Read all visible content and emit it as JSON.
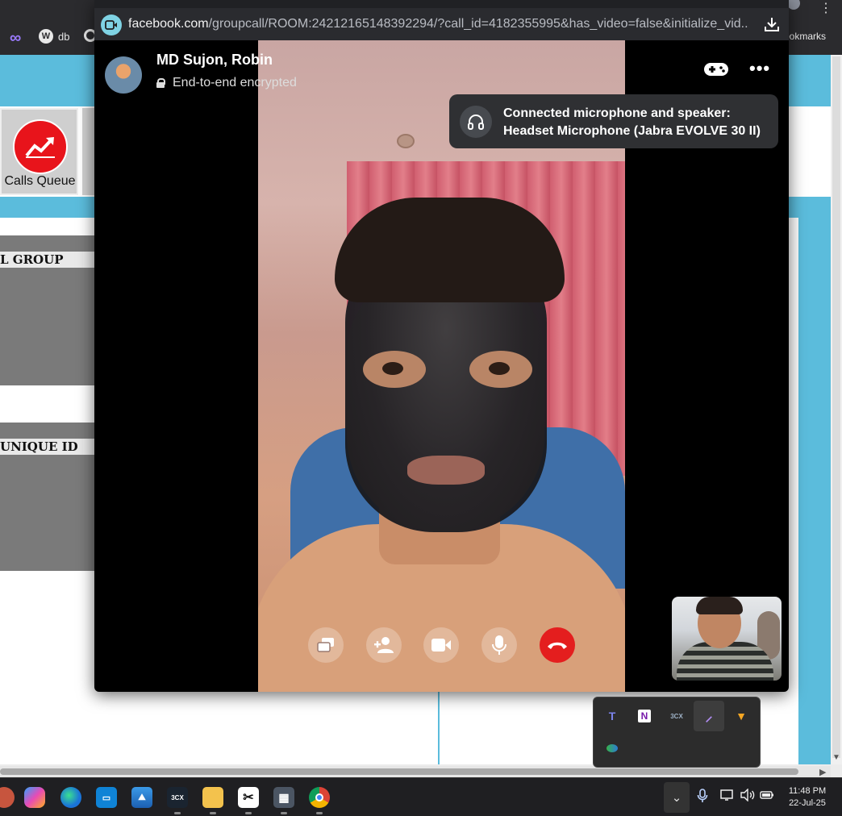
{
  "background": {
    "bookmarks": {
      "db_label": "db",
      "bookmarks_label": "ookmarks"
    },
    "calls_queue_label": "Calls Queue",
    "panel_group_heading": "L GROUP",
    "panel_unique_heading": "UNIQUE ID"
  },
  "popup": {
    "url": {
      "host": "facebook.com",
      "path": "/groupcall/ROOM:24212165148392294/?call_id=4182355995&has_video=false&initialize_vid..."
    },
    "caller": {
      "name": "MD Sujon, Robin",
      "encryption": "End-to-end encrypted"
    },
    "toast": {
      "line1": "Connected microphone and speaker:",
      "line2": "Headset Microphone (Jabra EVOLVE 30 II)"
    },
    "controls": [
      "share-screen",
      "add-person",
      "video",
      "microphone",
      "end-call"
    ]
  },
  "tray_popup_icons": [
    "teams",
    "onenote",
    "3cx",
    "feather",
    "vlc-style-orange",
    "green-globe"
  ],
  "taskbar": {
    "apps": [
      "copilot",
      "edge",
      "app-blue",
      "photos",
      "3cx",
      "file-explorer",
      "snipping-tool",
      "calculator",
      "chrome"
    ],
    "clock": {
      "time": "11:48 PM",
      "date": "22-Jul-25"
    }
  },
  "colors": {
    "facebook_icon": "#7fd3e4",
    "end_call": "#e41e1e",
    "page_accent": "#5bbcdc",
    "calls_queue_icon": "#e8141b"
  }
}
